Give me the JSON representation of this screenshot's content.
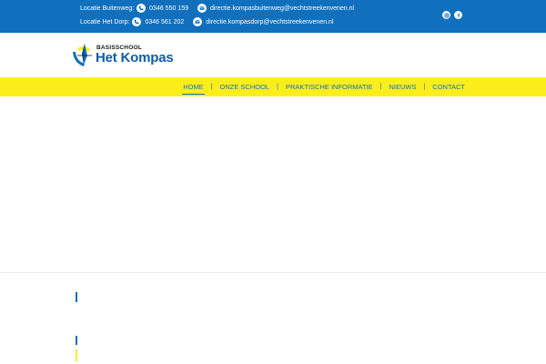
{
  "topbar": {
    "locations": [
      {
        "label": "Locatie Buitenweg:",
        "phone": "0346 550 159",
        "email": "directie.kompasbuitenweg@vechtstreekenvenen.nl"
      },
      {
        "label": "Locatie Het Dorp:",
        "phone": "0346 561 202",
        "email": "directie.kompasdorp@vechtstreekenvenen.nl"
      }
    ],
    "social": [
      "instagram-icon",
      "facebook-icon"
    ]
  },
  "logo": {
    "small": "BASISSCHOOL",
    "big": "Het Kompas"
  },
  "nav": {
    "items": [
      "HOME",
      "ONZE SCHOOL",
      "PRAKTISCHE INFORMATIE",
      "NIEUWS",
      "CONTACT"
    ],
    "separator": "|",
    "active": "HOME"
  },
  "colors": {
    "brand_blue": "#1070bd",
    "brand_yellow": "#fbee1b",
    "background": "#ffffff"
  }
}
